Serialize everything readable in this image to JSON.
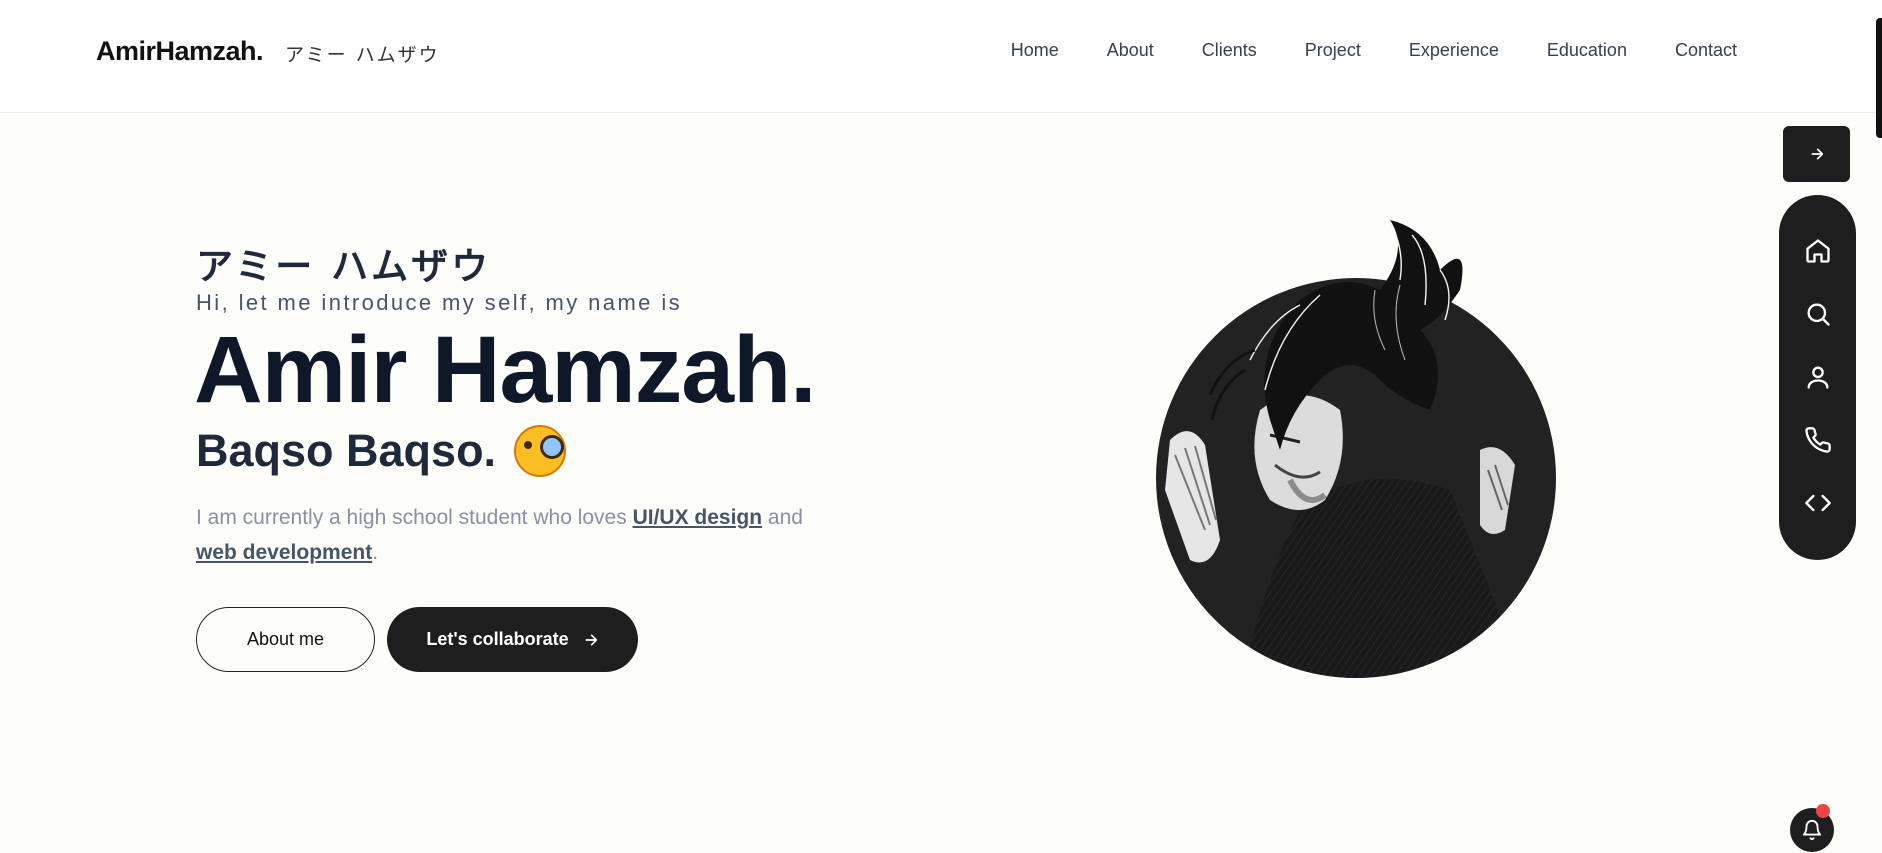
{
  "header": {
    "brand": "AmirHamzah.",
    "brand_jp": "アミー ハムザウ",
    "nav": [
      "Home",
      "About",
      "Clients",
      "Project",
      "Experience",
      "Education",
      "Contact"
    ]
  },
  "hero": {
    "jp_name": "アミー ハムザウ",
    "intro": "Hi, let me introduce my self, my name is",
    "name": "Amir Hamzah.",
    "subtitle": "Baqso Baqso.",
    "emoji_icon": "face-with-monocle-icon",
    "desc_prefix": "I am currently a high school student who loves ",
    "desc_link1": "UI/UX design",
    "desc_mid": " and ",
    "desc_link2": "web development",
    "desc_suffix": ".",
    "btn_about": "About me",
    "btn_collab": "Let's collaborate"
  },
  "dock": {
    "items": [
      "home-icon",
      "search-icon",
      "user-icon",
      "phone-icon",
      "code-icon"
    ]
  },
  "colors": {
    "background": "#fdfdfa",
    "dark": "#1e1e1e",
    "text": "#0f172a",
    "muted": "#8691a3",
    "notification": "#ef4444"
  }
}
